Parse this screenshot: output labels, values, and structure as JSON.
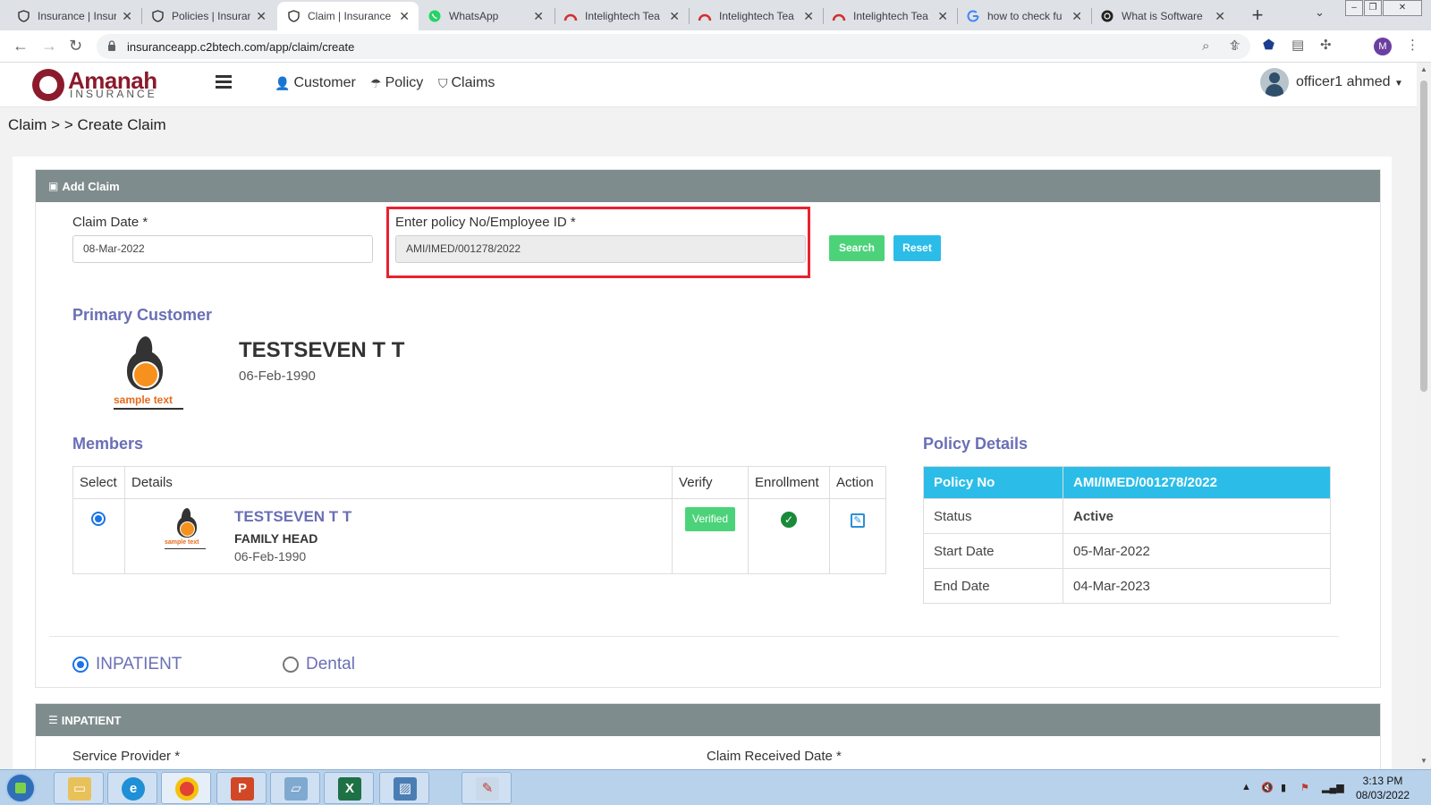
{
  "browser": {
    "tabs": [
      {
        "title": "Insurance | Insur",
        "icon": "shield-icon"
      },
      {
        "title": "Policies | Insuran",
        "icon": "shield-icon"
      },
      {
        "title": "Claim | Insurance",
        "icon": "shield-icon"
      },
      {
        "title": "WhatsApp",
        "icon": "whatsapp-icon"
      },
      {
        "title": "Intelightech Tea",
        "icon": "intelightech-icon"
      },
      {
        "title": "Intelightech Tea",
        "icon": "intelightech-icon"
      },
      {
        "title": "Intelightech Tea",
        "icon": "intelightech-icon"
      },
      {
        "title": "how to check fu",
        "icon": "google-icon"
      },
      {
        "title": "What is Software",
        "icon": "web-icon"
      }
    ],
    "url": "insuranceapp.c2btech.com/app/claim/create",
    "profile_initial": "M"
  },
  "app": {
    "logo_text": "Amanah",
    "logo_sub": "INSURANCE",
    "nav": [
      {
        "label": "Customer",
        "icon": "user-icon"
      },
      {
        "label": "Policy",
        "icon": "umbrella-icon"
      },
      {
        "label": "Claims",
        "icon": "shield-icon"
      }
    ],
    "user_name": "officer1 ahmed"
  },
  "breadcrumb": "Claim > > Create Claim",
  "add_claim": {
    "header": "Add Claim",
    "claim_date_label": "Claim Date *",
    "claim_date_value": "08-Mar-2022",
    "policy_label": "Enter policy No/Employee ID *",
    "policy_value": "AMI/IMED/001278/2022",
    "search_label": "Search",
    "reset_label": "Reset"
  },
  "primary_customer": {
    "title": "Primary Customer",
    "name": "TESTSEVEN T T",
    "dob": "06-Feb-1990",
    "logo_text": "sample text"
  },
  "members": {
    "title": "Members",
    "headers": [
      "Select",
      "Details",
      "Verify",
      "Enrollment",
      "Action"
    ],
    "rows": [
      {
        "name": "TESTSEVEN T T",
        "relation": "FAMILY HEAD",
        "dob": "06-Feb-1990",
        "verify": "Verified",
        "logo_text": "sample text"
      }
    ]
  },
  "policy_details": {
    "title": "Policy Details",
    "header_label": "Policy No",
    "header_value": "AMI/IMED/001278/2022",
    "rows": [
      {
        "label": "Status",
        "value": "Active"
      },
      {
        "label": "Start Date",
        "value": "05-Mar-2022"
      },
      {
        "label": "End Date",
        "value": "04-Mar-2023"
      }
    ]
  },
  "claim_types": [
    "INPATIENT",
    "Dental"
  ],
  "inpatient": {
    "header": "INPATIENT",
    "service_provider_label": "Service Provider *",
    "claim_received_label": "Claim Received Date *"
  },
  "taskbar": {
    "time": "3:13 PM",
    "date": "08/03/2022"
  },
  "colors": {
    "panel_header": "#7f8c8d",
    "accent_cyan": "#2bbde8",
    "accent_green": "#4cd37a",
    "section_title": "#6a6fb5",
    "highlight_red": "#e8222f",
    "status_active": "#15841f"
  }
}
